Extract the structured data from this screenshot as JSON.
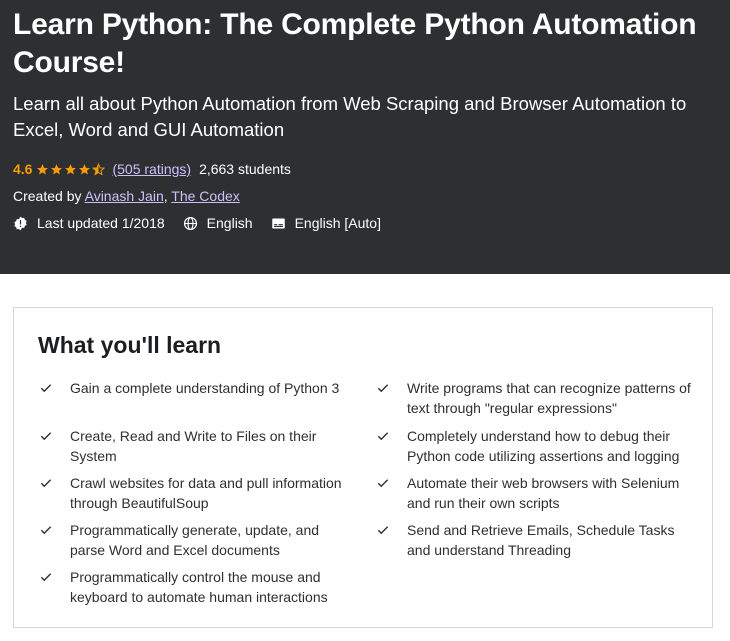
{
  "course": {
    "title": "Learn Python: The Complete Python Automation Course!",
    "subtitle": "Learn all about Python Automation from Web Scraping and Browser Automation to Excel, Word and GUI Automation",
    "rating": "4.6",
    "rating_stars": 4.5,
    "ratings_link": "(505 ratings)",
    "students": "2,663 students",
    "created_by_label": "Created by",
    "authors": [
      "Avinash Jain",
      "The Codex"
    ],
    "last_updated": "Last updated 1/2018",
    "language": "English",
    "captions": "English [Auto]"
  },
  "colors": {
    "hero_bg": "#2d2f31",
    "rating_orange": "#f69c08",
    "link_purple": "#cec0fc"
  },
  "icons": {
    "updated": "alert-badge-icon",
    "language": "globe-icon",
    "captions": "closed-captions-icon",
    "learn_item": "checkmark-icon"
  },
  "learn": {
    "title": "What you'll learn",
    "left": [
      "Gain a complete understanding of Python 3",
      "Create, Read and Write to Files on their System",
      "Crawl websites for data and pull information through BeautifulSoup",
      "Programmatically generate, update, and parse Word and Excel documents",
      "Programmatically control the mouse and keyboard to automate human interactions"
    ],
    "right": [
      "Write programs that can recognize patterns of text through \"regular expressions\"",
      "Completely understand how to debug their Python code utilizing assertions and logging",
      "Automate their web browsers with Selenium and run their own scripts",
      "Send and Retrieve Emails, Schedule Tasks and understand Threading"
    ]
  }
}
